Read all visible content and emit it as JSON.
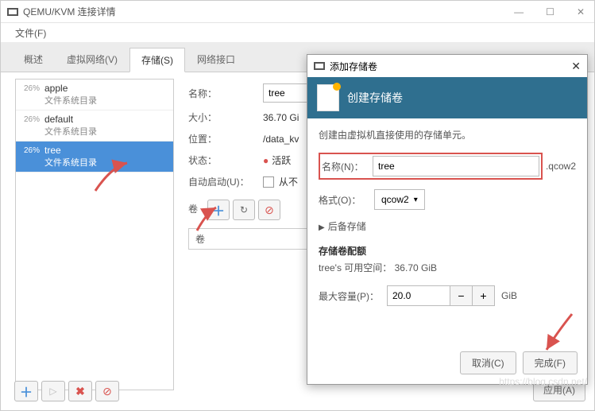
{
  "window": {
    "title": "QEMU/KVM 连接详情",
    "menu_file": "文件(F)"
  },
  "tabs": {
    "overview": "概述",
    "vnet": "虚拟网络(V)",
    "storage": "存储(S)",
    "netif": "网络接口"
  },
  "pools": [
    {
      "pct": "26%",
      "name": "apple",
      "sub": "文件系统目录"
    },
    {
      "pct": "26%",
      "name": "default",
      "sub": "文件系统目录"
    },
    {
      "pct": "26%",
      "name": "tree",
      "sub": "文件系统目录"
    }
  ],
  "detail": {
    "name_label": "名称：",
    "name_value": "tree",
    "size_label": "大小：",
    "size_value": "36.70 Gi",
    "loc_label": "位置：",
    "loc_value": "/data_kv",
    "state_label": "状态：",
    "state_value": "活跃",
    "autostart_label": "自动启动(U)：",
    "autostart_suffix": "从不",
    "vol_label": "卷",
    "vol_col": "卷"
  },
  "dialog": {
    "title": "添加存储卷",
    "banner_title": "创建存储卷",
    "desc": "创建由虚拟机直接使用的存储单元。",
    "name_label": "名称(N)：",
    "name_value": "tree",
    "name_suffix": ".qcow2",
    "format_label": "格式(O)：",
    "format_value": "qcow2",
    "backing_label": "后备存储",
    "quota_title": "存储卷配额",
    "quota_line": "tree's 可用空间： 36.70 GiB",
    "cap_label": "最大容量(P)：",
    "cap_value": "20.0",
    "cap_unit": "GiB",
    "btn_cancel": "取消(C)",
    "btn_finish": "完成(F)"
  },
  "apply_label": "应用(A)",
  "watermark": "https://blog.csdn.net/"
}
